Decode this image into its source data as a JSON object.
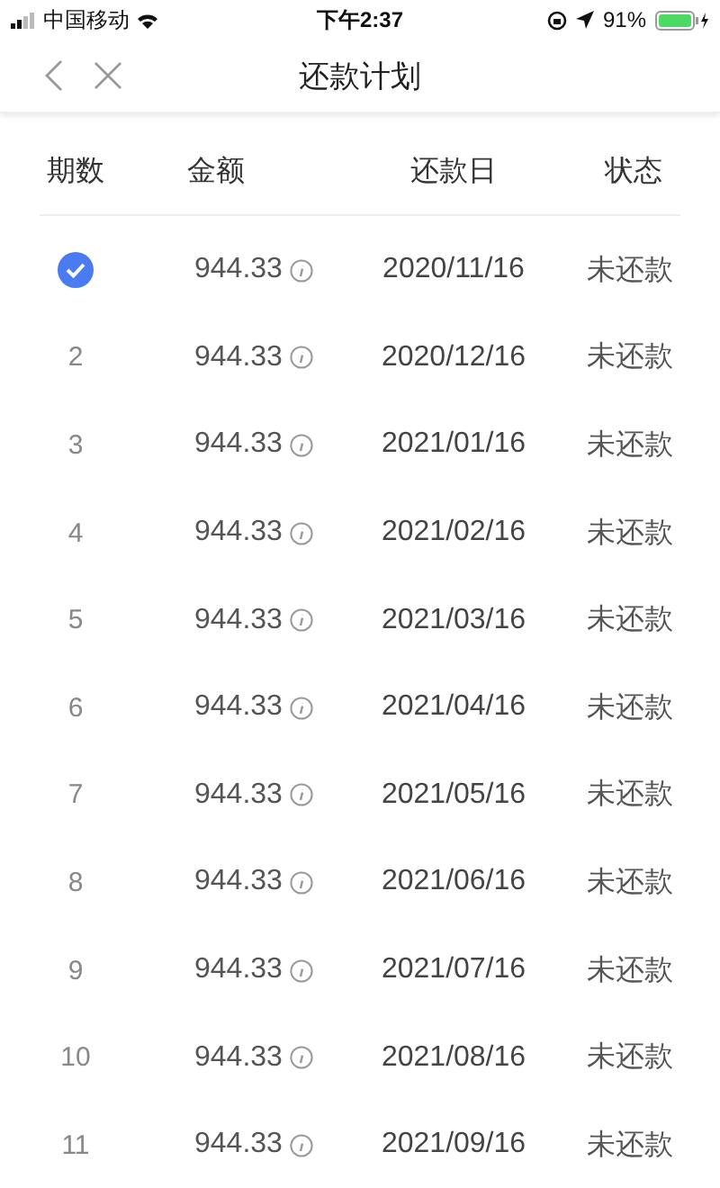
{
  "status_bar": {
    "carrier": "中国移动",
    "time": "下午2:37",
    "battery_percent": "91%"
  },
  "nav": {
    "title": "还款计划"
  },
  "table": {
    "columns": [
      "期数",
      "金额",
      "还款日",
      "状态"
    ],
    "rows": [
      {
        "checked": true,
        "amount": "944.33",
        "date": "2020/11/16",
        "status": "未还款"
      },
      {
        "checked": false,
        "period": "2",
        "amount": "944.33",
        "date": "2020/12/16",
        "status": "未还款"
      },
      {
        "checked": false,
        "period": "3",
        "amount": "944.33",
        "date": "2021/01/16",
        "status": "未还款"
      },
      {
        "checked": false,
        "period": "4",
        "amount": "944.33",
        "date": "2021/02/16",
        "status": "未还款"
      },
      {
        "checked": false,
        "period": "5",
        "amount": "944.33",
        "date": "2021/03/16",
        "status": "未还款"
      },
      {
        "checked": false,
        "period": "6",
        "amount": "944.33",
        "date": "2021/04/16",
        "status": "未还款"
      },
      {
        "checked": false,
        "period": "7",
        "amount": "944.33",
        "date": "2021/05/16",
        "status": "未还款"
      },
      {
        "checked": false,
        "period": "8",
        "amount": "944.33",
        "date": "2021/06/16",
        "status": "未还款"
      },
      {
        "checked": false,
        "period": "9",
        "amount": "944.33",
        "date": "2021/07/16",
        "status": "未还款"
      },
      {
        "checked": false,
        "period": "10",
        "amount": "944.33",
        "date": "2021/08/16",
        "status": "未还款"
      },
      {
        "checked": false,
        "period": "11",
        "amount": "944.33",
        "date": "2021/09/16",
        "status": "未还款"
      }
    ]
  }
}
